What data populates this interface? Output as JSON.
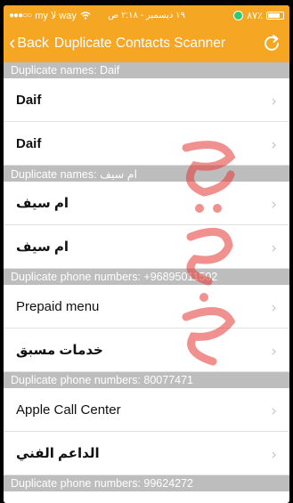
{
  "status_bar": {
    "carrier": "my ﻻ way",
    "datetime": "١٩ ديسمبر - ٢:١٨ ص",
    "battery": "٨٧٪"
  },
  "nav": {
    "back_label": "Back",
    "title": "Duplicate Contacts Scanner"
  },
  "sections": [
    {
      "header": "Duplicate names:  Daif",
      "rows": [
        "Daif",
        "Daif"
      ]
    },
    {
      "header": "Duplicate names:  ام سيف",
      "rows": [
        "ام سيف",
        "ام سيف"
      ]
    },
    {
      "header": "Duplicate phone numbers:  +96895011502",
      "rows": [
        "Prepaid menu",
        "خدمات مسبق"
      ]
    },
    {
      "header": "Duplicate phone numbers:  80077471",
      "rows": [
        "Apple Call Center",
        "الداعم الفني"
      ]
    },
    {
      "header": "Duplicate phone numbers:  99624272",
      "rows": []
    }
  ],
  "colors": {
    "accent": "#f5a623",
    "section_bg": "#bdbdbd",
    "watermark": "#e53935"
  },
  "icons": {
    "back": "chevron-left-icon",
    "refresh": "refresh-icon",
    "row_arrow": "chevron-right-icon"
  }
}
